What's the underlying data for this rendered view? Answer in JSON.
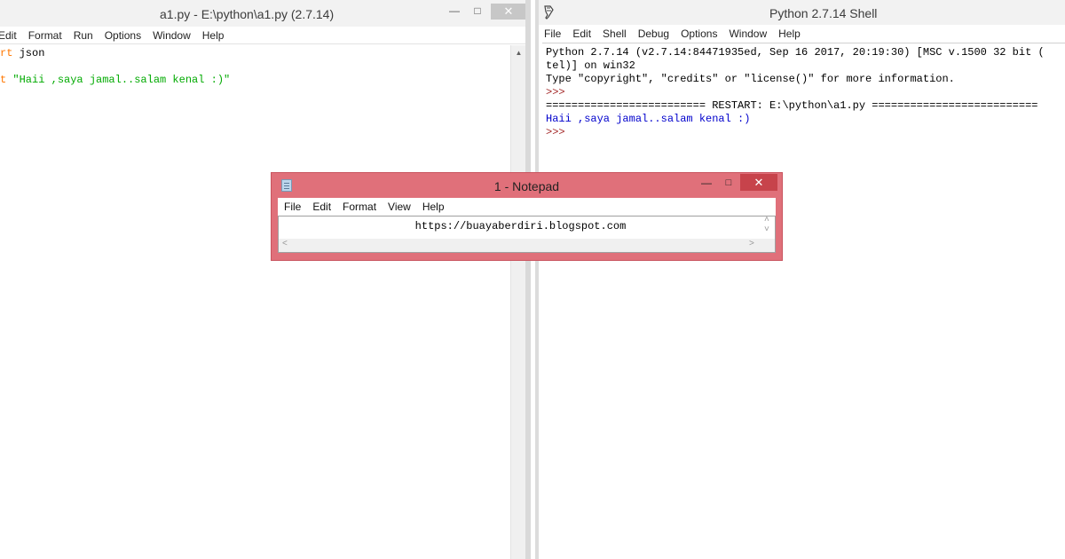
{
  "editor_window": {
    "title": "a1.py - E:\\python\\a1.py (2.7.14)",
    "min_glyph": "—",
    "max_glyph": "□",
    "close_glyph": "✕",
    "menu": [
      "Edit",
      "Format",
      "Run",
      "Options",
      "Window",
      "Help"
    ],
    "code": {
      "line1_kw": "rt",
      "line1_rest": " json",
      "line2_kw": "t",
      "line2_str": "\"Haii ,saya jamal..salam kenal :)\""
    },
    "scroll_up_glyph": "▲"
  },
  "shell_window": {
    "title": "Python 2.7.14 Shell",
    "min_glyph": "—",
    "max_glyph": "□",
    "close_glyph": "✕",
    "menu": [
      "File",
      "Edit",
      "Shell",
      "Debug",
      "Options",
      "Window",
      "Help"
    ],
    "lines": {
      "banner1": "Python 2.7.14 (v2.7.14:84471935ed, Sep 16 2017, 20:19:30) [MSC v.1500 32 bit (",
      "banner2": "tel)] on win32",
      "banner3": "Type \"copyright\", \"credits\" or \"license()\" for more information.",
      "prompt1": ">>>",
      "restart": "========================= RESTART: E:\\python\\a1.py ==========================",
      "output": "Haii ,saya jamal..salam kenal :)",
      "prompt2": ">>>"
    }
  },
  "notepad": {
    "title": "1 - Notepad",
    "min_glyph": "—",
    "max_glyph": "□",
    "close_glyph": "✕",
    "menu": [
      "File",
      "Edit",
      "Format",
      "View",
      "Help"
    ],
    "content": "https://buayaberdiri.blogspot.com",
    "up_glyph": "˄",
    "down_glyph": "˅",
    "left_glyph": "<",
    "right_glyph": ">"
  },
  "colors": {
    "keyword": "#ff7700",
    "string": "#00aa00",
    "prompt": "#a52a2a",
    "output": "#0000cc",
    "notepad_frame": "#e0707a",
    "close_button": "#c7434b"
  }
}
